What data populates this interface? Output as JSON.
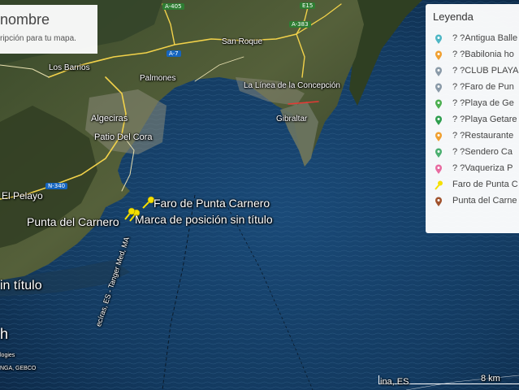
{
  "title_box": {
    "title": "nombre",
    "description": "ripción para tu mapa."
  },
  "legend": {
    "heading": "Leyenda",
    "items": [
      {
        "label": "? ?Antigua Balle",
        "color": "#4db6c4",
        "icon": "map-pin-icon"
      },
      {
        "label": "? ?Babilonia ho",
        "color": "#f0a030",
        "icon": "map-pin-icon"
      },
      {
        "label": "? ?CLUB PLAYA",
        "color": "#8a9aa8",
        "icon": "map-pin-icon"
      },
      {
        "label": "? ?Faro de Pun",
        "color": "#8a9aa8",
        "icon": "map-pin-icon"
      },
      {
        "label": "? ?Playa de Ge",
        "color": "#4caf50",
        "icon": "map-pin-icon"
      },
      {
        "label": "? ?Playa Getare",
        "color": "#2e9e4e",
        "icon": "map-pin-icon"
      },
      {
        "label": "? ?Restaurante",
        "color": "#f0a030",
        "icon": "map-pin-icon"
      },
      {
        "label": "? ?Sendero Ca",
        "color": "#4caf70",
        "icon": "map-pin-icon"
      },
      {
        "label": "? ?Vaqueriza P",
        "color": "#e86aa0",
        "icon": "map-pin-icon"
      },
      {
        "label": "Faro de Punta C",
        "color": "#f5e000",
        "icon": "pushpin-icon"
      },
      {
        "label": "Punta del Carne",
        "color": "#a0522d",
        "icon": "map-pin-icon"
      }
    ]
  },
  "places": {
    "los_barrios": "Los Barrios",
    "san_roque": "San Roque",
    "palmones": "Palmones",
    "la_linea": "La Línea de la Concepción",
    "algeciras": "Algeciras",
    "patio_del_cora": "Patio Del Cora",
    "gibraltar": "Gibraltar",
    "el_pelayo": "El Pelayo",
    "punta_del_carnero": "Punta del Carnero",
    "faro": "Faro de Punta Carnero",
    "marca": "Marca de posición sin título",
    "sin_titulo": "in título",
    "fragment_h": "h"
  },
  "roads": {
    "a405": "A-405",
    "e15": "E15",
    "a383": "A-383",
    "a7": "A-7",
    "n340": "N-340"
  },
  "route_label": "ecíras, ES - Tanger Med, MA",
  "attribution": {
    "line1": "logies",
    "line2": "NGA, GEBCO"
  },
  "scale": {
    "label": "8 km",
    "left_text": "ina, ES"
  },
  "colors": {
    "sea": "#11375a",
    "land": "#3c4a2c",
    "pin_yellow": "#f5e000"
  }
}
